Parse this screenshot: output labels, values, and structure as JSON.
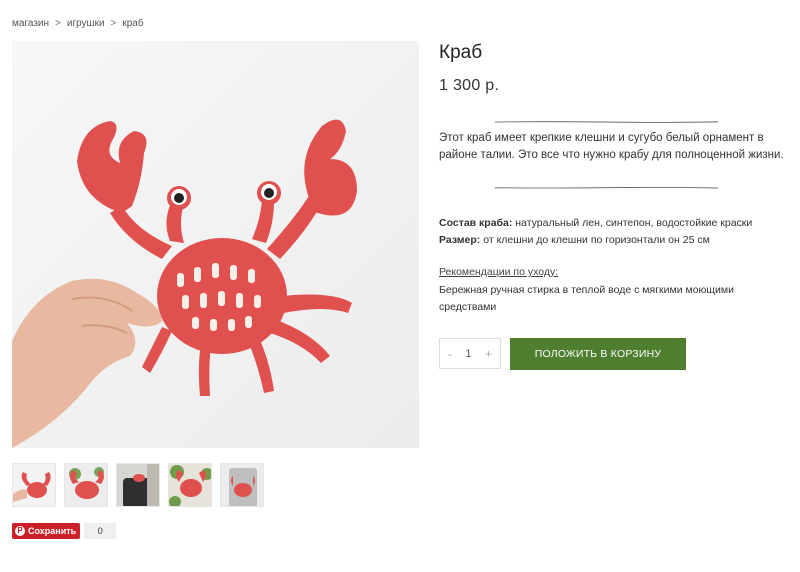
{
  "breadcrumb": {
    "items": [
      "магазин",
      "игрушки",
      "краб"
    ],
    "separator": ">"
  },
  "product": {
    "title": "Краб",
    "price": "1 300 р.",
    "description": "Этот краб имеет крепкие клешни и сугубо белый орнамент в районе талии. Это все что нужно крабу для полноценной жизни.",
    "composition_label": "Состав краба:",
    "composition_value": " натуральный лен, синтепон, водостойкие краски",
    "size_label": "Размер:",
    "size_value": " от клешни до клешни по горизонтали он 25 см",
    "care_title": "Рекомендации по уходу:",
    "care_text": "Бережная ручная стирка в теплой воде с мягкими моющими средствами"
  },
  "cart": {
    "minus": "-",
    "quantity": "1",
    "plus": "+",
    "add_label": "ПОЛОЖИТЬ В КОРЗИНУ"
  },
  "share": {
    "pin_label": "Сохранить",
    "pin_logo": "P",
    "count": "0"
  },
  "colors": {
    "accent_green": "#4f7f2e",
    "pinterest_red": "#cb2027",
    "crab_red": "#e0504f"
  }
}
